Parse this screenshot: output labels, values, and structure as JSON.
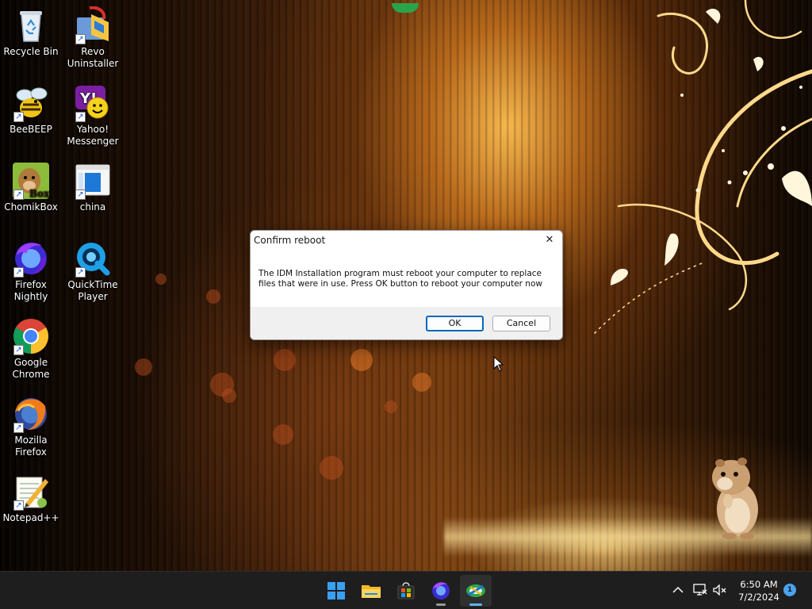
{
  "desktop": {
    "icons": [
      {
        "label": "Recycle Bin",
        "icon": "recycle-bin-icon"
      },
      {
        "label": "Revo Uninstaller",
        "icon": "revo-uninstaller-icon"
      },
      {
        "label": "BeeBEEP",
        "icon": "beebeep-icon"
      },
      {
        "label": "Yahoo! Messenger",
        "icon": "yahoo-messenger-icon"
      },
      {
        "label": "ChomikBox",
        "icon": "chomikbox-icon",
        "badge_text": "Box"
      },
      {
        "label": "china",
        "icon": "document-window-icon"
      },
      {
        "label": "Firefox Nightly",
        "icon": "firefox-nightly-icon"
      },
      {
        "label": "QuickTime Player",
        "icon": "quicktime-icon"
      },
      {
        "label": "Google Chrome",
        "icon": "chrome-icon"
      },
      {
        "label": "Mozilla Firefox",
        "icon": "firefox-icon"
      },
      {
        "label": "Notepad++",
        "icon": "notepad-plus-plus-icon"
      }
    ]
  },
  "dialog": {
    "title": "Confirm reboot",
    "close_glyph": "✕",
    "message_line1": "The IDM Installation program must reboot your computer to replace",
    "message_line2": "files that were in use. Press OK button to reboot your computer now",
    "ok_label": "OK",
    "cancel_label": "Cancel"
  },
  "taskbar": {
    "apps": [
      {
        "name": "start",
        "icon": "windows-start-icon"
      },
      {
        "name": "file-explorer",
        "icon": "folder-icon"
      },
      {
        "name": "microsoft-store",
        "icon": "store-icon"
      },
      {
        "name": "firefox-nightly",
        "icon": "firefox-nightly-icon"
      },
      {
        "name": "idm-installer",
        "icon": "idm-icon"
      }
    ],
    "tray": {
      "chevron_glyph": "^",
      "time": "6:50 AM",
      "date": "7/2/2024",
      "notification_count": "1"
    }
  },
  "colors": {
    "accent": "#0067c0",
    "taskbar_bg": "#1e1e1e",
    "dialog_footer": "#f0f0f0"
  }
}
